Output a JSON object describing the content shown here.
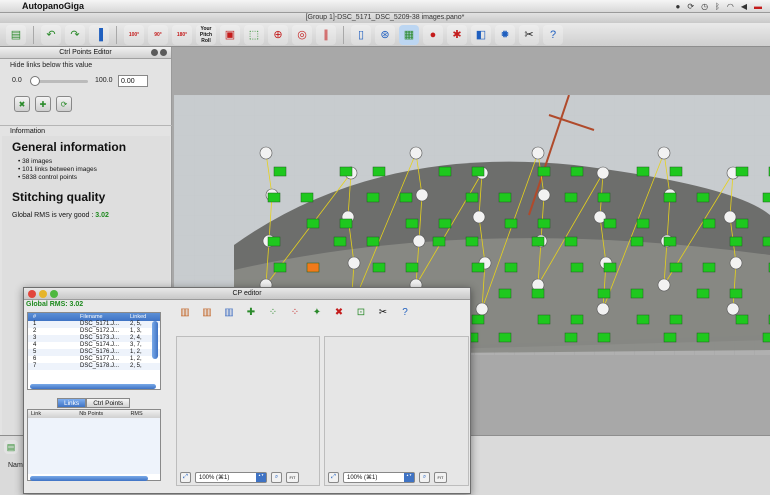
{
  "menubar": {
    "app_name": "AutopanoGiga"
  },
  "window": {
    "title": "[Group 1]-DSC_5171_DSC_5209-38 images.pano*"
  },
  "toolbar": {
    "wpb_label": "Your Pitch Roll",
    "zoom_100": "100°",
    "zoom_90": "90°",
    "zoom_180": "180°"
  },
  "ctrl_panel": {
    "title": "Ctrl Points Editor",
    "hide_links_label": "Hide links below this value",
    "slider_min": "0.0",
    "slider_max": "100.0",
    "slider_value": "0.00"
  },
  "information": {
    "header": "Information",
    "general_title": "General information",
    "items": [
      "38 images",
      "101 links between images",
      "5838 control points"
    ],
    "quality_title": "Stitching quality",
    "rms_text": "Global RMS is very good :",
    "rms_value": "3.02"
  },
  "cp_editor": {
    "title": "CP editor",
    "global_rms": "Global RMS: 3.02",
    "images_table": {
      "headers": [
        "#",
        "Filename",
        "Linked"
      ],
      "rows": [
        [
          "1",
          "DSC_5171.J...",
          "2, 5,"
        ],
        [
          "2",
          "DSC_5172.J...",
          "1, 3,"
        ],
        [
          "3",
          "DSC_5173.J...",
          "2, 4,"
        ],
        [
          "4",
          "DSC_5174.J...",
          "3, 7,"
        ],
        [
          "5",
          "DSC_5176.J...",
          "1, 2,"
        ],
        [
          "6",
          "DSC_5177.J...",
          "1, 2,"
        ],
        [
          "7",
          "DSC_5178.J...",
          "2, 5,"
        ]
      ]
    },
    "tabs": [
      "Links",
      "Ctrl Points"
    ],
    "links_table": {
      "headers": [
        "Link",
        "Nb Points",
        "RMS"
      ]
    },
    "zoom_left": "100% (⌘1)",
    "zoom_right": "100% (⌘1)",
    "fit_label": "FIT"
  },
  "bottom_panel": {
    "name_label": "Name"
  },
  "colors": {
    "good_marker": "#1ec81e",
    "warn_marker": "#f07a1a",
    "link_line": "#e6d21c"
  }
}
